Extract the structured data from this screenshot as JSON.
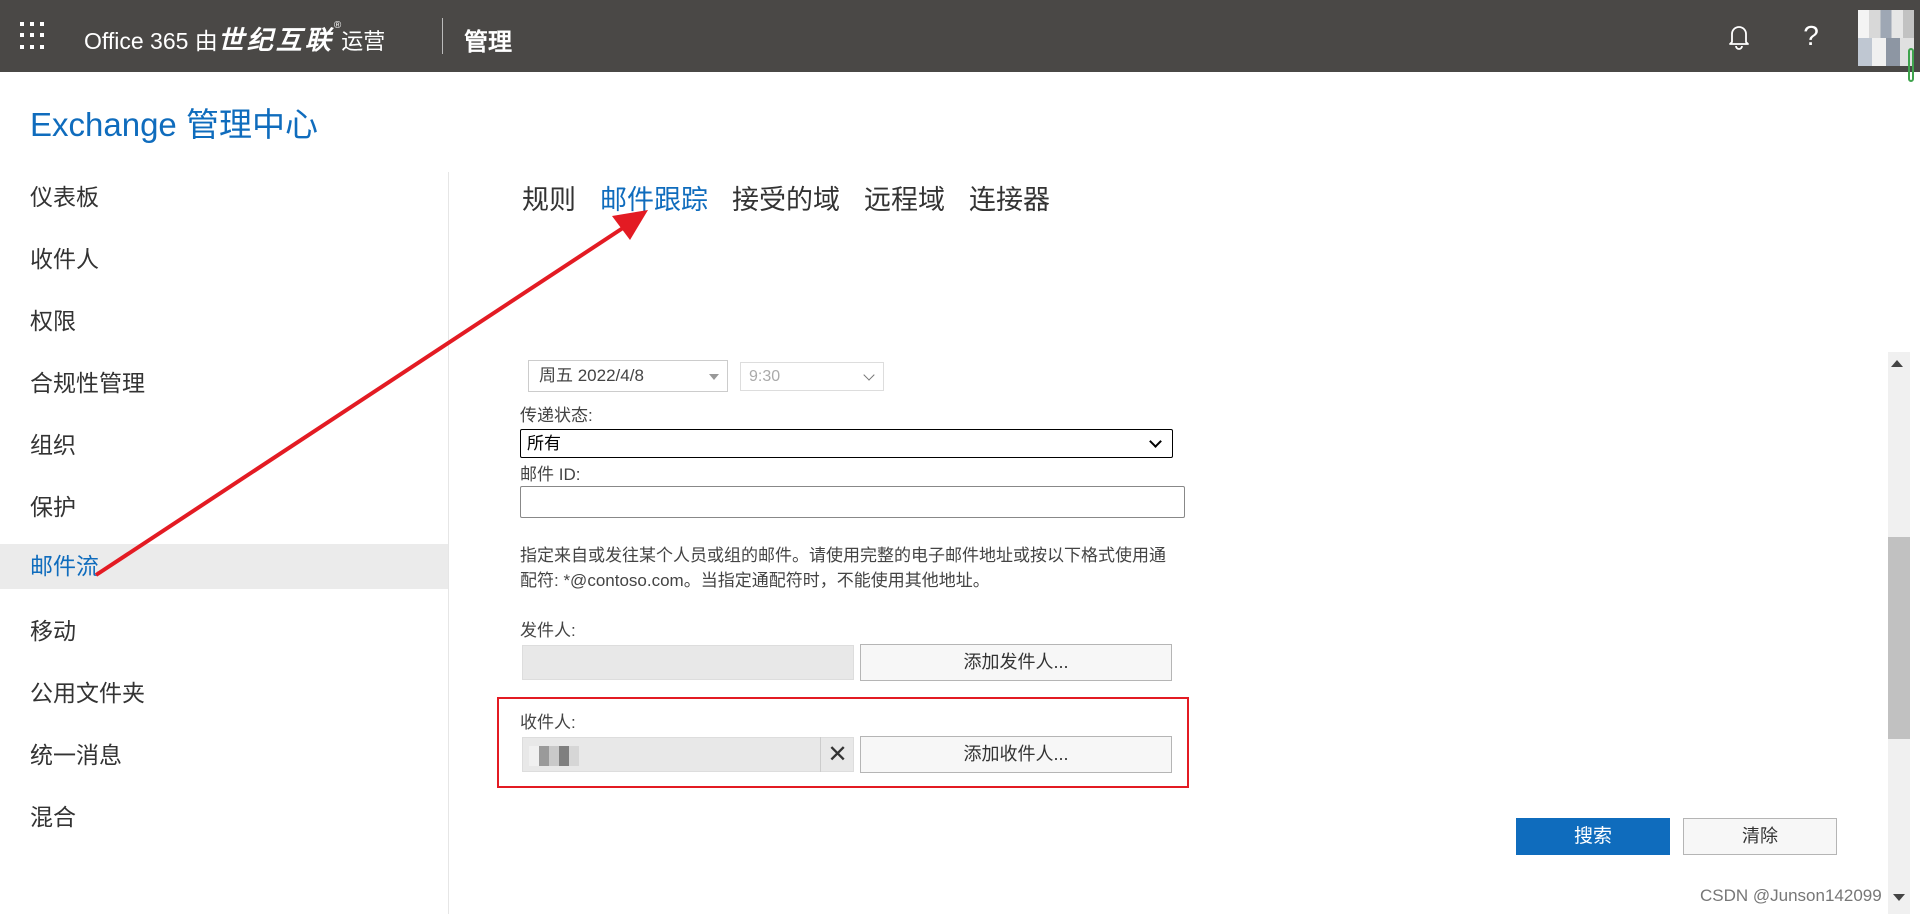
{
  "topbar": {
    "brand_main": "Office 365 由",
    "brand_partner": "世纪互联",
    "brand_reg": "®",
    "brand_op": "运营",
    "admin_label": "管理",
    "help_glyph": "?"
  },
  "app_title": "Exchange 管理中心",
  "leftnav": {
    "items": [
      {
        "label": "仪表板"
      },
      {
        "label": "收件人"
      },
      {
        "label": "权限"
      },
      {
        "label": "合规性管理"
      },
      {
        "label": "组织"
      },
      {
        "label": "保护"
      },
      {
        "label": "邮件流"
      },
      {
        "label": "移动"
      },
      {
        "label": "公用文件夹"
      },
      {
        "label": "统一消息"
      },
      {
        "label": "混合"
      }
    ],
    "active_index": 6
  },
  "tabs": [
    {
      "label": "规则"
    },
    {
      "label": "邮件跟踪"
    },
    {
      "label": "接受的域"
    },
    {
      "label": "远程域"
    },
    {
      "label": "连接器"
    }
  ],
  "form": {
    "date_value": "周五 2022/4/8",
    "time_value": "9:30",
    "delivery_status_label": "传递状态:",
    "delivery_status_value": "所有",
    "message_id_label": "邮件 ID:",
    "message_id_value": "",
    "help_text": "指定来自或发往某个人员或组的邮件。请使用完整的电子邮件地址或按以下格式使用通配符: *@contoso.com。当指定通配符时，不能使用其他地址。",
    "sender_label": "发件人:",
    "add_sender_button": "添加发件人...",
    "recipient_label": "收件人:",
    "remove_glyph": "✕",
    "add_recipient_button": "添加收件人...",
    "search_button": "搜索",
    "clear_button": "清除"
  },
  "colors": {
    "accent": "#0f6cbd",
    "topbar": "#4a4846",
    "annotation_red": "#e31b23"
  },
  "watermark": "CSDN @Junson142099"
}
